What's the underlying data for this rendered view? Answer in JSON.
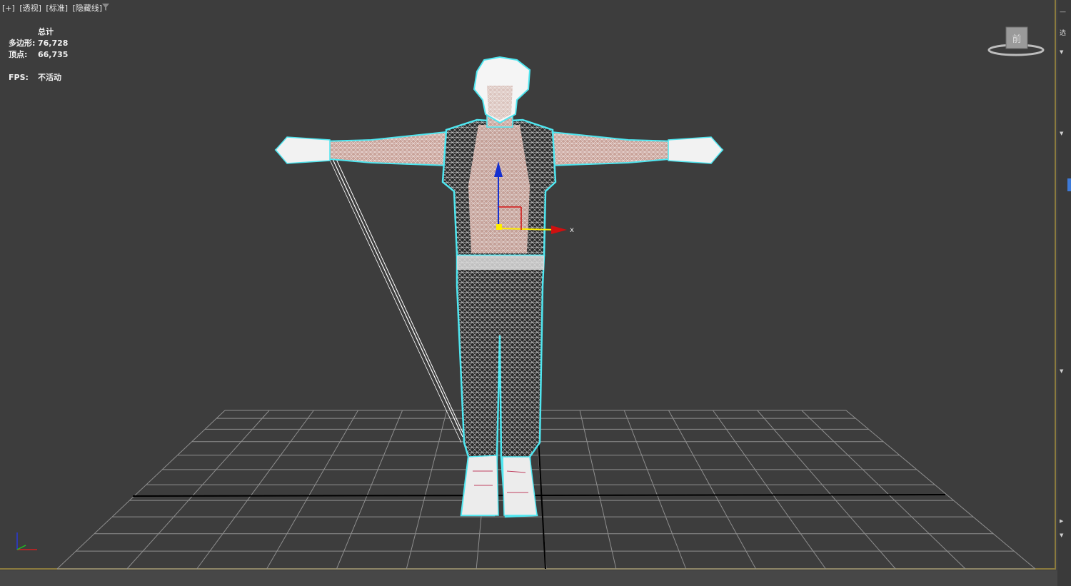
{
  "viewport": {
    "label_parts": [
      "[+]",
      "[透视]",
      "[标准]",
      "[隐藏线]"
    ]
  },
  "stats": {
    "header": "总计",
    "polygons_label": "多边形:",
    "polygons_value": "76,728",
    "vertices_label": "顶点:",
    "vertices_value": "66,735",
    "fps_label": "FPS:",
    "fps_value": "不活动"
  },
  "gizmo": {
    "x_label": "x"
  },
  "viewcube": {
    "face_label": "前"
  },
  "colors": {
    "viewport_bg": "#3d3d3d",
    "grid": "#9a9a9a",
    "selection_outline": "#4fe6f0",
    "wire": "#ffffff",
    "active_border": "#8a7a3e"
  },
  "right_panel": {
    "top_char": "—",
    "side_char": "选"
  }
}
